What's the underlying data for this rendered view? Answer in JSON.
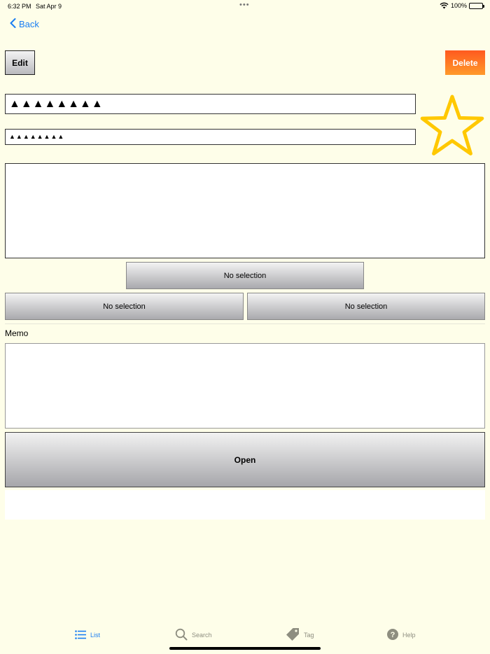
{
  "status_bar": {
    "time": "6:32 PM",
    "date": "Sat Apr 9",
    "dots": "•••",
    "battery": "100%"
  },
  "nav": {
    "back_label": "Back"
  },
  "toolbar": {
    "edit_label": "Edit",
    "delete_label": "Delete"
  },
  "fields": {
    "title_value": "▲▲▲▲▲▲▲▲",
    "subtitle_value": "▲▲▲▲▲▲▲▲"
  },
  "pickers": {
    "top": "No selection",
    "left": "No selection",
    "right": "No selection"
  },
  "memo": {
    "label": "Memo"
  },
  "open_label": "Open",
  "tabs": [
    {
      "label": "List",
      "icon": "list-icon",
      "active": true
    },
    {
      "label": "Search",
      "icon": "search-icon",
      "active": false
    },
    {
      "label": "Tag",
      "icon": "tag-icon",
      "active": false
    },
    {
      "label": "Help",
      "icon": "help-icon",
      "active": false
    }
  ],
  "colors": {
    "background": "#fefee9",
    "accent": "#1a7ef2",
    "delete": "#ff7a2a",
    "star": "#ffc800"
  }
}
